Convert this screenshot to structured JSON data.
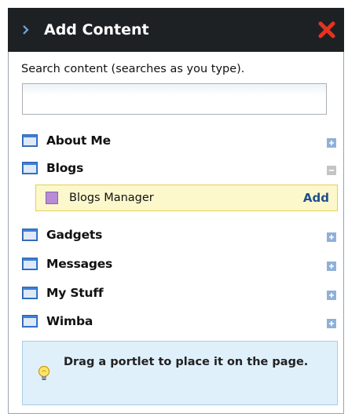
{
  "header": {
    "title": "Add Content",
    "close_icon": "close-icon",
    "arrow_icon": "chevron-right-icon"
  },
  "search": {
    "label": "Search content (searches as you type).",
    "value": "",
    "placeholder": ""
  },
  "categories": [
    {
      "label": "About Me",
      "state": "collapsed"
    },
    {
      "label": "Blogs",
      "state": "expanded"
    },
    {
      "label": "Gadgets",
      "state": "collapsed"
    },
    {
      "label": "Messages",
      "state": "collapsed"
    },
    {
      "label": "My Stuff",
      "state": "collapsed"
    },
    {
      "label": "Wimba",
      "state": "collapsed"
    }
  ],
  "blogs_items": [
    {
      "label": "Blogs Manager",
      "action": "Add"
    }
  ],
  "hint": {
    "text": "Drag a portlet to place it on the page."
  },
  "colors": {
    "header_bg": "#1e2124",
    "accent_blue": "#1f4f8c",
    "close_red": "#e8321e",
    "highlight_bg": "#fdf8cc",
    "hint_bg": "#dff0fb"
  }
}
